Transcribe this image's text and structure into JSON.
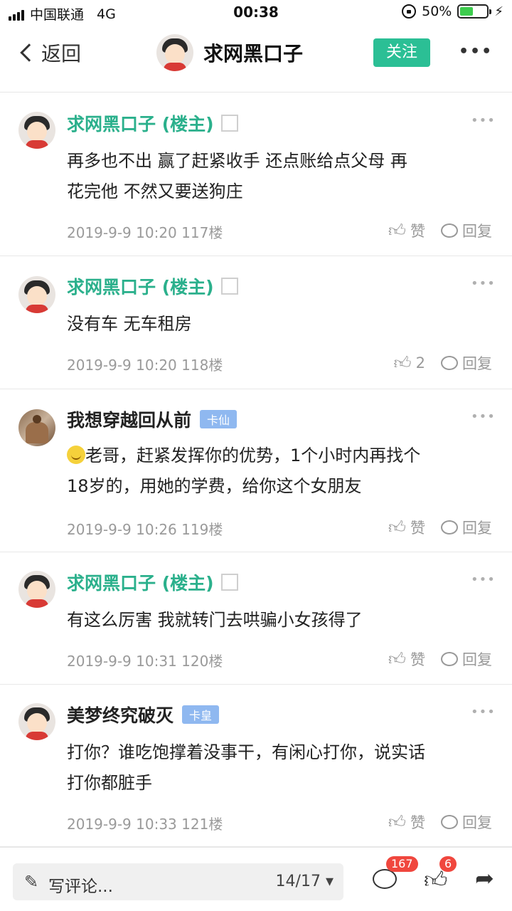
{
  "statusbar": {
    "carrier": "中国联通",
    "network": "4G",
    "time": "00:38",
    "battery": "50%",
    "battery_level": 0.5
  },
  "nav": {
    "back_label": "返回",
    "title": "求网黑口子",
    "follow_label": "关注",
    "more_icon": "more-icon"
  },
  "posts": [
    {
      "author": "求网黑口子 (楼主)",
      "is_op": true,
      "text_lines": [
        "再多也不出  赢了赶紧收手  还点账给点父母  再",
        "花完他  不然又要送狗庄"
      ],
      "time": "2019-9-9 10:20",
      "floor": "117楼",
      "like_label": "赞",
      "reply_label": "回复"
    },
    {
      "author": "求网黑口子 (楼主)",
      "is_op": true,
      "text_lines": [
        "没有车  无车租房"
      ],
      "time": "2019-9-9 10:20",
      "floor": "118楼",
      "like_label": "2",
      "reply_label": "回复"
    },
    {
      "author": "我想穿越回从前",
      "tag": "卡仙",
      "text_lines": [
        "老哥，赶紧发挥你的优势，1个小时内再找个",
        "18岁的，用她的学费，给你这个女朋友"
      ],
      "time": "2019-9-9 10:26",
      "floor": "119楼",
      "like_label": "赞",
      "reply_label": "回复"
    },
    {
      "author": "求网黑口子 (楼主)",
      "is_op": true,
      "text_lines": [
        "有这么厉害  我就转门去哄骗小女孩得了"
      ],
      "time": "2019-9-9 10:31",
      "floor": "120楼",
      "like_label": "赞",
      "reply_label": "回复"
    },
    {
      "author": "美梦终究破灭",
      "tag": "卡皇",
      "text_lines": [
        "打你？谁吃饱撑着没事干，有闲心打你，说实话",
        "打你都脏手"
      ],
      "time": "2019-9-9 10:33",
      "floor": "121楼",
      "like_label": "赞",
      "reply_label": "回复"
    }
  ],
  "bottombar": {
    "comment_placeholder": "写评论...",
    "page_indicator": "14/17",
    "comment_count": "167",
    "like_count": "6"
  },
  "colors": {
    "accent": "#2bbf95",
    "op_name": "#2bb08c",
    "tag": "#8fb8f0",
    "badge": "#f0473e"
  }
}
